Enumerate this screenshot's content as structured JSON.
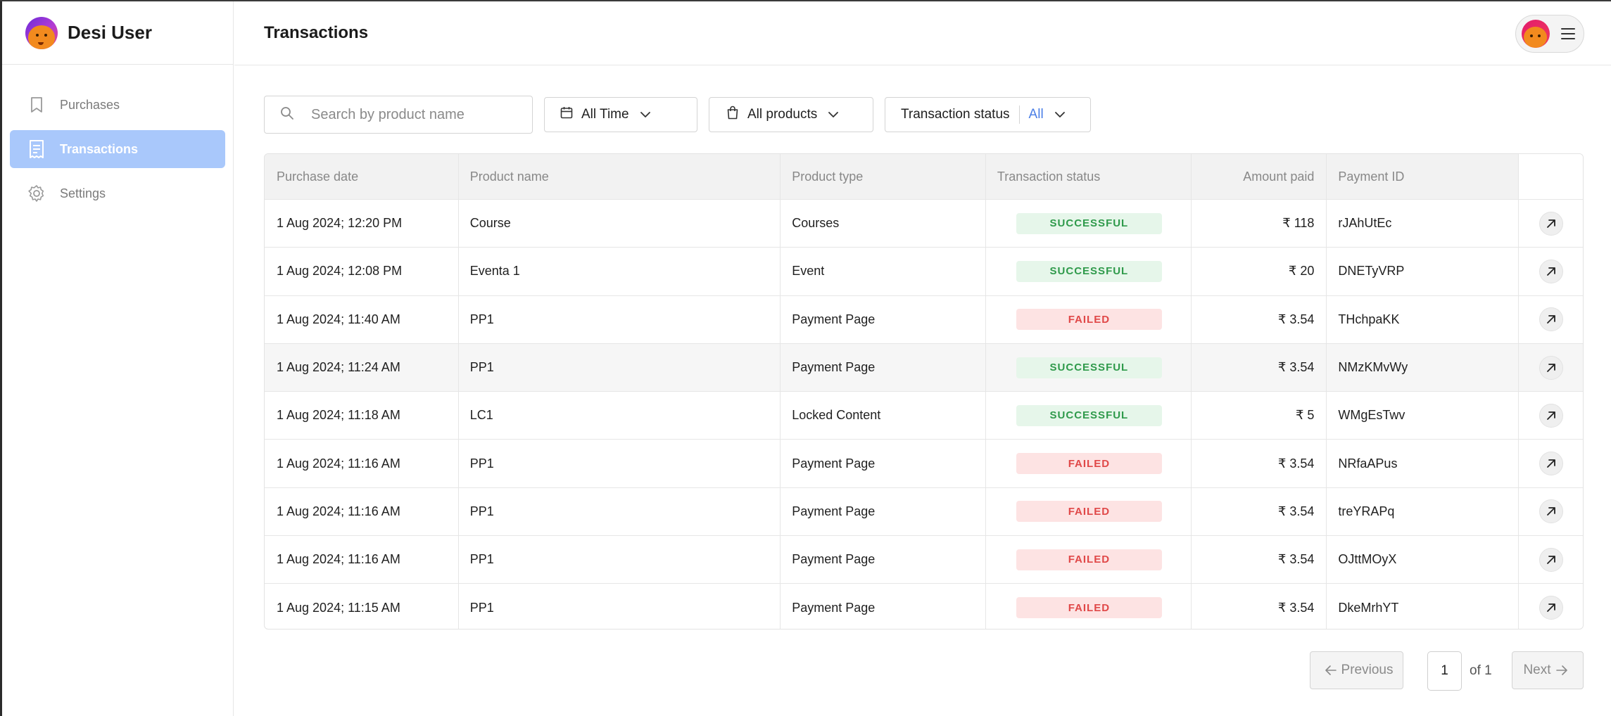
{
  "sidebar": {
    "brand_name": "Desi User",
    "items": [
      {
        "label": "Purchases",
        "icon": "bookmark-icon",
        "active": false
      },
      {
        "label": "Transactions",
        "icon": "receipt-icon",
        "active": true
      },
      {
        "label": "Settings",
        "icon": "gear-icon",
        "active": false
      }
    ]
  },
  "header": {
    "title": "Transactions"
  },
  "filters": {
    "search_placeholder": "Search by product name",
    "search_value": "",
    "time_label": "All Time",
    "products_label": "All products",
    "status_label": "Transaction status",
    "status_value": "All"
  },
  "table": {
    "columns": [
      "Purchase date",
      "Product name",
      "Product type",
      "Transaction status",
      "Amount paid",
      "Payment ID"
    ],
    "rows": [
      {
        "date": "1 Aug 2024; 12:20 PM",
        "product": "Course",
        "type": "Courses",
        "status": "SUCCESSFUL",
        "amount": "₹ 118",
        "payment_id": "rJAhUtEc"
      },
      {
        "date": "1 Aug 2024; 12:08 PM",
        "product": "Eventa 1",
        "type": "Event",
        "status": "SUCCESSFUL",
        "amount": "₹ 20",
        "payment_id": "DNETyVRP"
      },
      {
        "date": "1 Aug 2024; 11:40 AM",
        "product": "PP1",
        "type": "Payment Page",
        "status": "FAILED",
        "amount": "₹ 3.54",
        "payment_id": "THchpaKK"
      },
      {
        "date": "1 Aug 2024; 11:24 AM",
        "product": "PP1",
        "type": "Payment Page",
        "status": "SUCCESSFUL",
        "amount": "₹ 3.54",
        "payment_id": "NMzKMvWy"
      },
      {
        "date": "1 Aug 2024; 11:18 AM",
        "product": "LC1",
        "type": "Locked Content",
        "status": "SUCCESSFUL",
        "amount": "₹ 5",
        "payment_id": "WMgEsTwv"
      },
      {
        "date": "1 Aug 2024; 11:16 AM",
        "product": "PP1",
        "type": "Payment Page",
        "status": "FAILED",
        "amount": "₹ 3.54",
        "payment_id": "NRfaAPus"
      },
      {
        "date": "1 Aug 2024; 11:16 AM",
        "product": "PP1",
        "type": "Payment Page",
        "status": "FAILED",
        "amount": "₹ 3.54",
        "payment_id": "treYRAPq"
      },
      {
        "date": "1 Aug 2024; 11:16 AM",
        "product": "PP1",
        "type": "Payment Page",
        "status": "FAILED",
        "amount": "₹ 3.54",
        "payment_id": "OJttMOyX"
      },
      {
        "date": "1 Aug 2024; 11:15 AM",
        "product": "PP1",
        "type": "Payment Page",
        "status": "FAILED",
        "amount": "₹ 3.54",
        "payment_id": "DkeMrhYT"
      }
    ]
  },
  "pagination": {
    "previous_label": "Previous",
    "next_label": "Next",
    "current_page": "1",
    "of_label": "of 1"
  },
  "colors": {
    "active_nav_bg": "#a9c8fb",
    "success_bg": "#e6f6ea",
    "success_text": "#2f9a4b",
    "failed_bg": "#fde3e3",
    "failed_text": "#e04848",
    "status_value_text": "#4a7ee6"
  }
}
